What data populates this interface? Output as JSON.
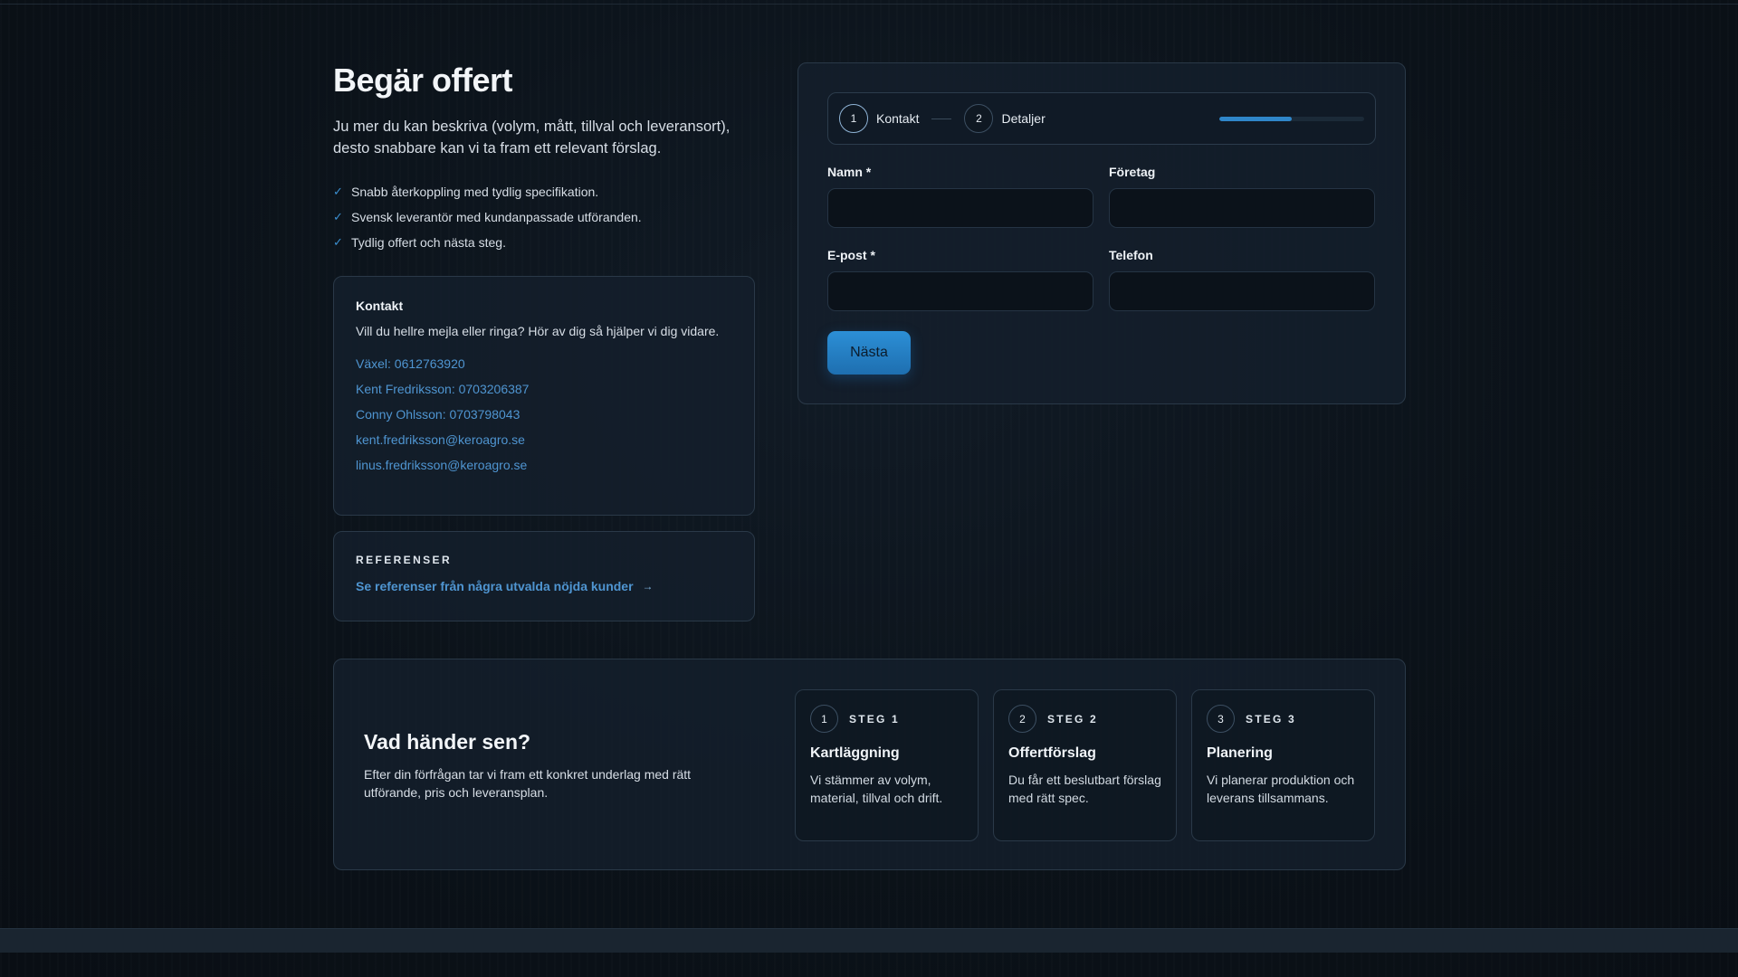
{
  "page": {
    "title": "Begär offert",
    "intro": "Ju mer du kan beskriva (volym, mått, tillval och leveransort), desto snabbare kan vi ta fram ett relevant förslag.",
    "bullets": [
      "Snabb återkoppling med tydlig specifikation.",
      "Svensk leverantör med kundanpassade utföranden.",
      "Tydlig offert och nästa steg."
    ],
    "check_icon": "✓"
  },
  "contact": {
    "title": "Kontakt",
    "description": "Vill du hellre mejla eller ringa? Hör av dig så hjälper vi dig vidare.",
    "links": [
      "Växel: 0612763920",
      "Kent Fredriksson: 0703206387",
      "Conny Ohlsson: 0703798043",
      "kent.fredriksson@keroagro.se",
      "linus.fredriksson@keroagro.se"
    ]
  },
  "references": {
    "label": "REFERENSER",
    "link_text": "Se referenser från några utvalda nöjda kunder",
    "arrow": "→"
  },
  "form": {
    "steps": [
      {
        "number": "1",
        "label": "Kontakt"
      },
      {
        "number": "2",
        "label": "Detaljer"
      }
    ],
    "progress": 0.5,
    "fields": {
      "name": {
        "label": "Namn *",
        "value": "",
        "placeholder": ""
      },
      "company": {
        "label": "Företag",
        "value": "",
        "placeholder": ""
      },
      "email": {
        "label": "E-post *",
        "value": "",
        "placeholder": ""
      },
      "phone": {
        "label": "Telefon",
        "value": "",
        "placeholder": ""
      }
    },
    "next_label": "Nästa"
  },
  "next_steps": {
    "title": "Vad händer sen?",
    "description": "Efter din förfrågan tar vi fram ett konkret underlag med rätt utförande, pris och leveransplan.",
    "cards": [
      {
        "number": "1",
        "label": "STEG 1",
        "title": "Kartläggning",
        "description": "Vi stämmer av volym, material, tillval och drift."
      },
      {
        "number": "2",
        "label": "STEG 2",
        "title": "Offertförslag",
        "description": "Du får ett beslutbart förslag med rätt spec."
      },
      {
        "number": "3",
        "label": "STEG 3",
        "title": "Planering",
        "description": "Vi planerar produktion och leverans tillsammans."
      }
    ]
  },
  "colors": {
    "accent": "#2f86c9",
    "link": "#4f95d1",
    "background": "#0b1118"
  }
}
